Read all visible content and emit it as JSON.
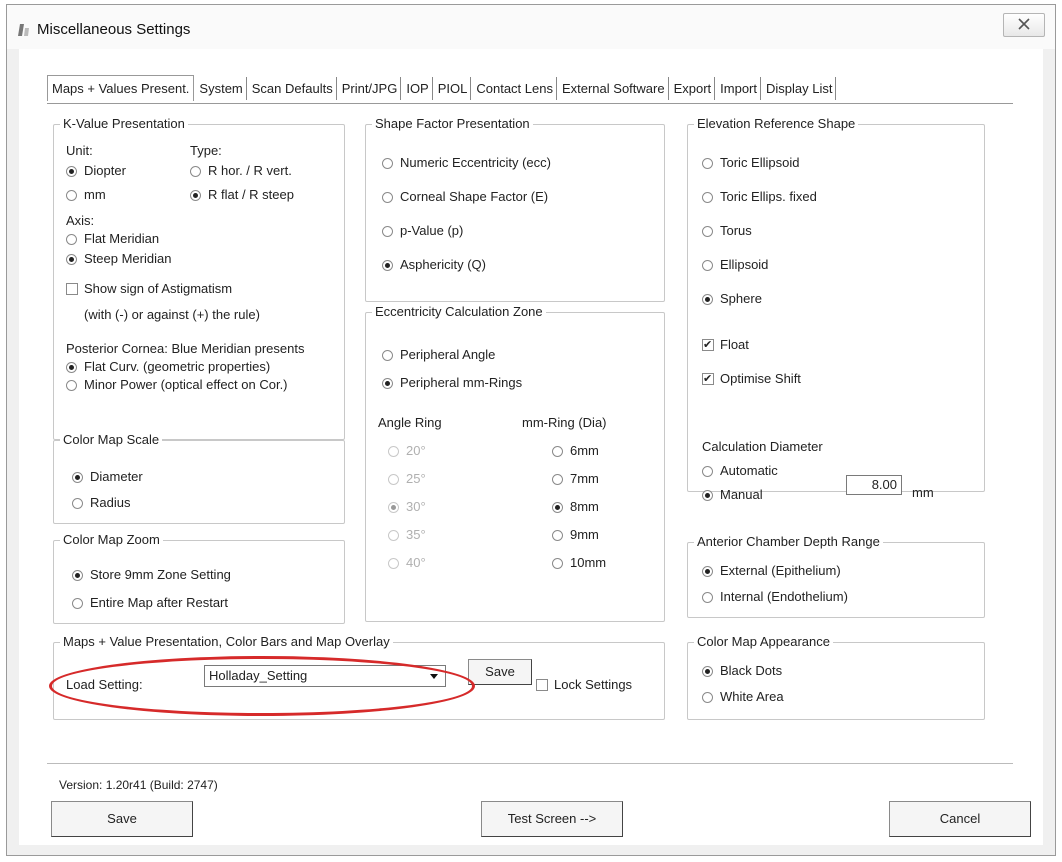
{
  "window": {
    "title": "Miscellaneous Settings",
    "close_label": "X"
  },
  "tabs": [
    "Maps + Values Present.",
    "System",
    "Scan Defaults",
    "Print/JPG",
    "IOP",
    "PIOL",
    "Contact Lens",
    "External Software",
    "Export",
    "Import",
    "Display List"
  ],
  "kvalue": {
    "legend": "K-Value Presentation",
    "unit_label": "Unit:",
    "type_label": "Type:",
    "unit_options": [
      "Diopter",
      "mm"
    ],
    "unit_selected": "Diopter",
    "type_options": [
      "R hor. / R vert.",
      "R flat / R steep"
    ],
    "type_selected": "R flat / R steep",
    "axis_label": "Axis:",
    "axis_options": [
      "Flat Meridian",
      "Steep Meridian"
    ],
    "axis_selected": "Steep Meridian",
    "astig_label": "Show sign of Astigmatism",
    "astig_checked": false,
    "astig_sub": "(with (-) or against (+) the rule)",
    "posterior_label": "Posterior Cornea: Blue Meridian presents",
    "posterior_options": [
      "Flat Curv. (geometric properties)",
      "Minor Power (optical effect on Cor.)"
    ],
    "posterior_selected": "Flat Curv. (geometric properties)"
  },
  "color_scale": {
    "legend": "Color Map Scale",
    "options": [
      "Diameter",
      "Radius"
    ],
    "selected": "Diameter"
  },
  "color_zoom": {
    "legend": "Color Map Zoom",
    "options": [
      "Store 9mm Zone Setting",
      "Entire Map after Restart"
    ],
    "selected": "Store 9mm Zone Setting"
  },
  "shape_factor": {
    "legend": "Shape Factor Presentation",
    "options": [
      "Numeric Eccentricity (ecc)",
      "Corneal Shape Factor (E)",
      "p-Value (p)",
      "Asphericity (Q)"
    ],
    "selected": "Asphericity (Q)"
  },
  "eccentricity": {
    "legend": "Eccentricity Calculation Zone",
    "options": [
      "Peripheral Angle",
      "Peripheral mm-Rings"
    ],
    "selected": "Peripheral mm-Rings",
    "angle_header": "Angle Ring",
    "mm_header": "mm-Ring (Dia)",
    "angles": [
      "20°",
      "25°",
      "30°",
      "35°",
      "40°"
    ],
    "angle_selected": "30°",
    "mm_rings": [
      "6mm",
      "7mm",
      "8mm",
      "9mm",
      "10mm"
    ],
    "mm_selected": "8mm"
  },
  "elevation": {
    "legend": "Elevation Reference Shape",
    "options": [
      "Toric Ellipsoid",
      "Toric Ellips. fixed",
      "Torus",
      "Ellipsoid",
      "Sphere"
    ],
    "selected": "Sphere",
    "float_label": "Float",
    "float_checked": true,
    "optimise_label": "Optimise Shift",
    "optimise_checked": true,
    "calc_label": "Calculation Diameter",
    "calc_options": [
      "Automatic",
      "Manual"
    ],
    "calc_selected": "Manual",
    "diameter_value": "8.00",
    "diameter_unit": "mm"
  },
  "anterior": {
    "legend": "Anterior Chamber Depth Range",
    "options": [
      "External (Epithelium)",
      "Internal (Endothelium)"
    ],
    "selected": "External (Epithelium)"
  },
  "appearance": {
    "legend": "Color Map Appearance",
    "options": [
      "Black Dots",
      "White Area"
    ],
    "selected": "Black Dots"
  },
  "overlay": {
    "legend": "Maps + Value Presentation, Color Bars and Map Overlay",
    "load_label": "Load Setting:",
    "load_value": "Holladay_Setting",
    "save_label": "Save",
    "lock_label": "Lock Settings",
    "lock_checked": false
  },
  "footer": {
    "version": "Version: 1.20r41  (Build: 2747)",
    "save_label": "Save",
    "test_label": "Test Screen -->",
    "cancel_label": "Cancel"
  },
  "colors": {
    "highlight": "#d62a2a"
  }
}
